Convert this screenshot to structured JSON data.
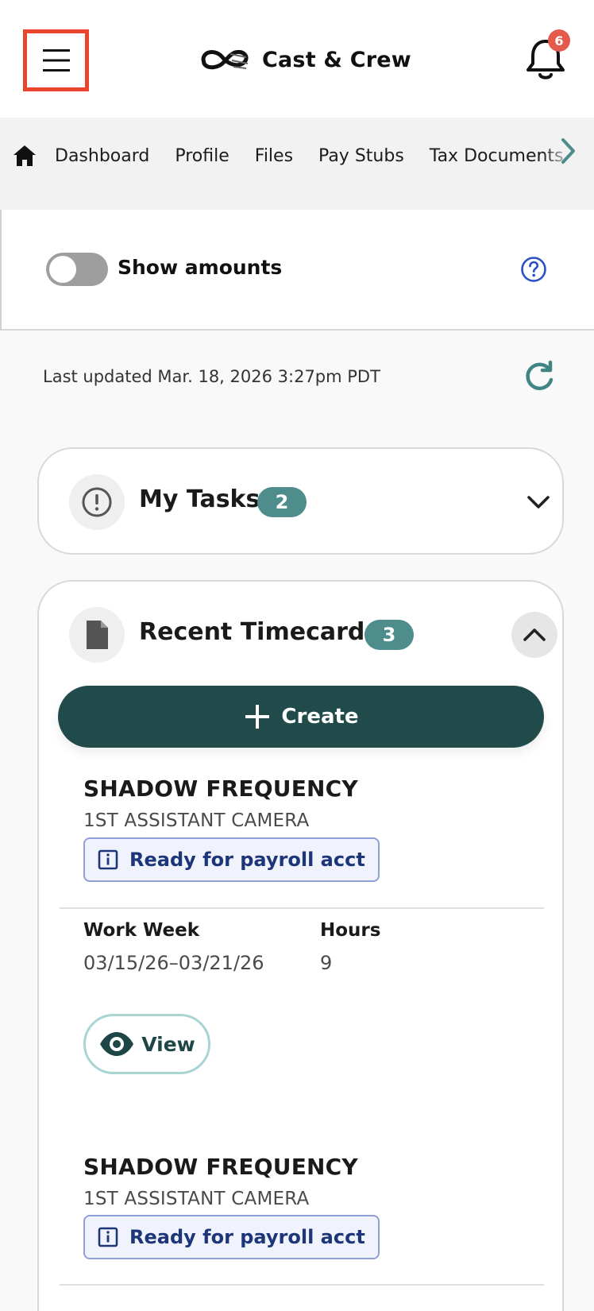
{
  "header": {
    "brand_name": "Cast & Crew",
    "notification_count": "6"
  },
  "nav": {
    "items": [
      {
        "label": "Dashboard"
      },
      {
        "label": "Profile"
      },
      {
        "label": "Files"
      },
      {
        "label": "Pay Stubs"
      },
      {
        "label": "Tax Documents"
      }
    ]
  },
  "amounts": {
    "label": "Show amounts",
    "toggle_on": false
  },
  "updated": {
    "text": "Last updated Mar. 18, 2026 3:27pm PDT"
  },
  "tasks": {
    "title": "My Tasks",
    "count": "2"
  },
  "timecards": {
    "title": "Recent Timecards",
    "count": "3",
    "create_label": "Create",
    "items": [
      {
        "production": "SHADOW FREQUENCY",
        "role": "1ST ASSISTANT CAMERA",
        "status": "Ready for payroll acct",
        "work_week_label": "Work Week",
        "work_week": "03/15/26–03/21/26",
        "hours_label": "Hours",
        "hours": "9",
        "view_label": "View"
      },
      {
        "production": "SHADOW FREQUENCY",
        "role": "1ST ASSISTANT CAMERA",
        "status": "Ready for payroll acct"
      }
    ]
  },
  "colors": {
    "accent_dark": "#214b4b",
    "badge_teal": "#4f8c8c",
    "status_blue": "#1d3579",
    "highlight_red": "#e8452c"
  },
  "icons": [
    "menu-icon",
    "brand-logo-icon",
    "bell-icon",
    "home-icon",
    "chevron-right-icon",
    "help-icon",
    "refresh-icon",
    "alert-icon",
    "chevron-down-icon",
    "document-icon",
    "chevron-up-icon",
    "plus-icon",
    "info-icon",
    "eye-icon"
  ]
}
